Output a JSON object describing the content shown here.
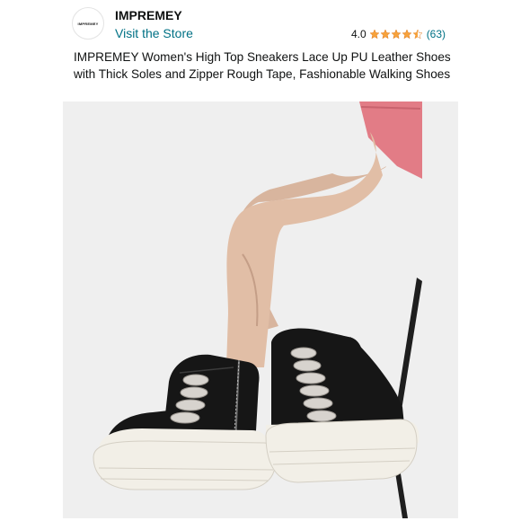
{
  "store": {
    "logo_text": "IMPREMEY",
    "name": "IMPREMEY",
    "link_label": "Visit the Store"
  },
  "rating": {
    "value": "4.0",
    "stars": 4,
    "count": "(63)"
  },
  "product": {
    "title": "IMPREMEY Women's High Top Sneakers Lace Up PU Leather Shoes with Thick Soles and Zipper Rough Tape, Fashionable Walking Shoes"
  },
  "colors": {
    "link": "#007185",
    "star": "#f7a23b",
    "text": "#0f1111"
  },
  "icons": {
    "star": "star-icon",
    "half_star": "star-half-icon"
  }
}
